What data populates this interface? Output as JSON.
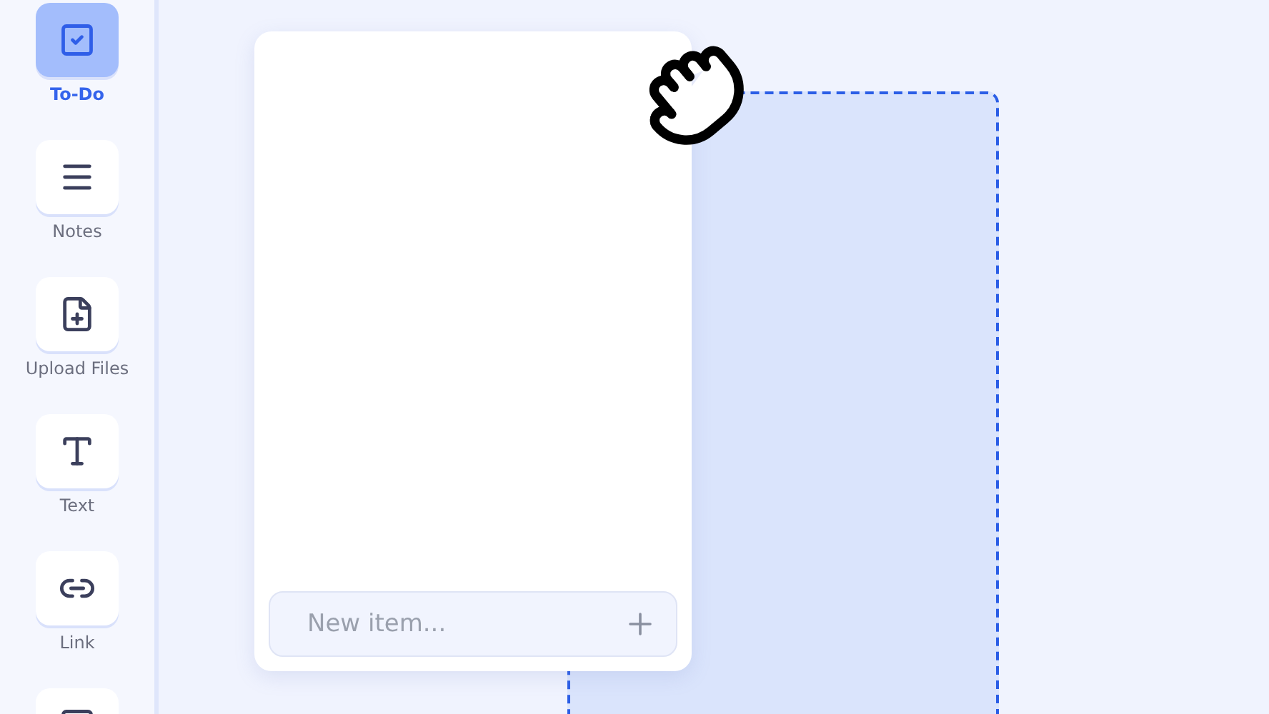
{
  "sidebar": {
    "tools": [
      {
        "label": "To-Do",
        "selected": true
      },
      {
        "label": "Notes",
        "selected": false
      },
      {
        "label": "Upload Files",
        "selected": false
      },
      {
        "label": "Text",
        "selected": false
      },
      {
        "label": "Link",
        "selected": false
      },
      {
        "selected": false
      }
    ]
  },
  "canvas": {
    "todo_card": {
      "new_item": {
        "placeholder": "New item..."
      }
    },
    "drop_zone": {
      "dragging": true
    }
  }
}
